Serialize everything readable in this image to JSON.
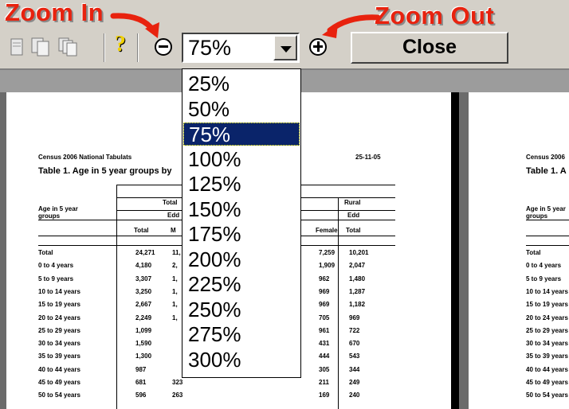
{
  "callouts": {
    "zoom_in": "Zoom In",
    "zoom_out": "Zoom Out"
  },
  "toolbar": {
    "zoom_value": "75%",
    "close_label": "Close",
    "help_glyph": "?"
  },
  "zoom_options": [
    "25%",
    "50%",
    "75%",
    "100%",
    "125%",
    "150%",
    "175%",
    "200%",
    "225%",
    "250%",
    "275%",
    "300%"
  ],
  "selected_zoom": "75%",
  "report": {
    "title": "Census 2006 National Tabulats",
    "date": "25-11-05",
    "table_title": "Table 1. Age in 5 year groups by",
    "header_total": "Total",
    "header_rural": "Rural",
    "header_sub1": "Edd",
    "header_sub2": "Edd",
    "col_total": "Total",
    "col_m": "M",
    "col_female": "Female",
    "col_total2": "Total",
    "row_header": "Age in 5 year",
    "row_header2": "groups",
    "rows": [
      {
        "label": "Total",
        "c1": "24,271",
        "c2": "11,",
        "c3": "7,259",
        "c4": "10,201"
      },
      {
        "label": "0 to 4 years",
        "c1": "4,180",
        "c2": "2,",
        "c3": "1,909",
        "c4": "2,047"
      },
      {
        "label": "5 to 9 years",
        "c1": "3,307",
        "c2": "1,",
        "c3": "962",
        "c4": "1,480"
      },
      {
        "label": "10 to 14 years",
        "c1": "3,250",
        "c2": "1,",
        "c3": "969",
        "c4": "1,287"
      },
      {
        "label": "15 to 19 years",
        "c1": "2,667",
        "c2": "1,",
        "c3": "969",
        "c4": "1,182"
      },
      {
        "label": "20 to 24 years",
        "c1": "2,249",
        "c2": "1,",
        "c3": "705",
        "c4": "969"
      },
      {
        "label": "25 to 29 years",
        "c1": "1,099",
        "c2": "",
        "c3": "961",
        "c4": "722"
      },
      {
        "label": "30 to 34 years",
        "c1": "1,590",
        "c2": "",
        "c3": "431",
        "c4": "670"
      },
      {
        "label": "35 to 39 years",
        "c1": "1,300",
        "c2": "",
        "c3": "444",
        "c4": "543"
      },
      {
        "label": "40 to 44 years",
        "c1": "987",
        "c2": "",
        "c3": "305",
        "c4": "344"
      },
      {
        "label": "45 to 49 years",
        "c1": "681",
        "c2": "323",
        "c3": "211",
        "c4": "249"
      },
      {
        "label": "50 to 54 years",
        "c1": "596",
        "c2": "263",
        "c3": "169",
        "c4": "240"
      }
    ],
    "right_page": {
      "title": "Census 2006",
      "table_title": "Table 1. A",
      "row_header": "Age in 5 year",
      "row_header2": "groups"
    }
  },
  "colors": {
    "accent_red": "#e8220e",
    "selection_blue": "#0a246a",
    "toolbar_grey": "#d4d0c8"
  }
}
